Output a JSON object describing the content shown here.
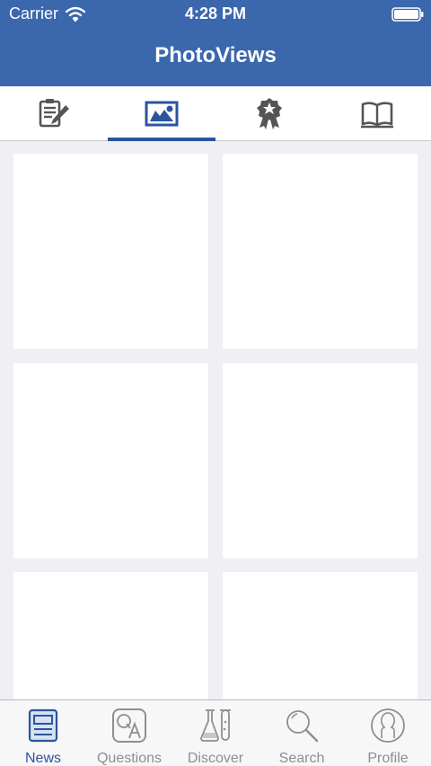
{
  "status_bar": {
    "carrier": "Carrier",
    "time": "4:28 PM"
  },
  "header": {
    "title": "PhotoViews"
  },
  "top_tabs": [
    {
      "icon": "edit-icon"
    },
    {
      "icon": "photo-icon",
      "active": true
    },
    {
      "icon": "award-icon"
    },
    {
      "icon": "book-icon"
    }
  ],
  "bottom_tabs": [
    {
      "label": "News",
      "icon": "news-icon",
      "active": true
    },
    {
      "label": "Questions",
      "icon": "qa-icon"
    },
    {
      "label": "Discover",
      "icon": "flask-icon"
    },
    {
      "label": "Search",
      "icon": "search-icon"
    },
    {
      "label": "Profile",
      "icon": "profile-icon"
    }
  ],
  "colors": {
    "accent": "#3b67ad",
    "active": "#2c549e",
    "inactive": "#8e8e93",
    "background": "#efeff4"
  }
}
